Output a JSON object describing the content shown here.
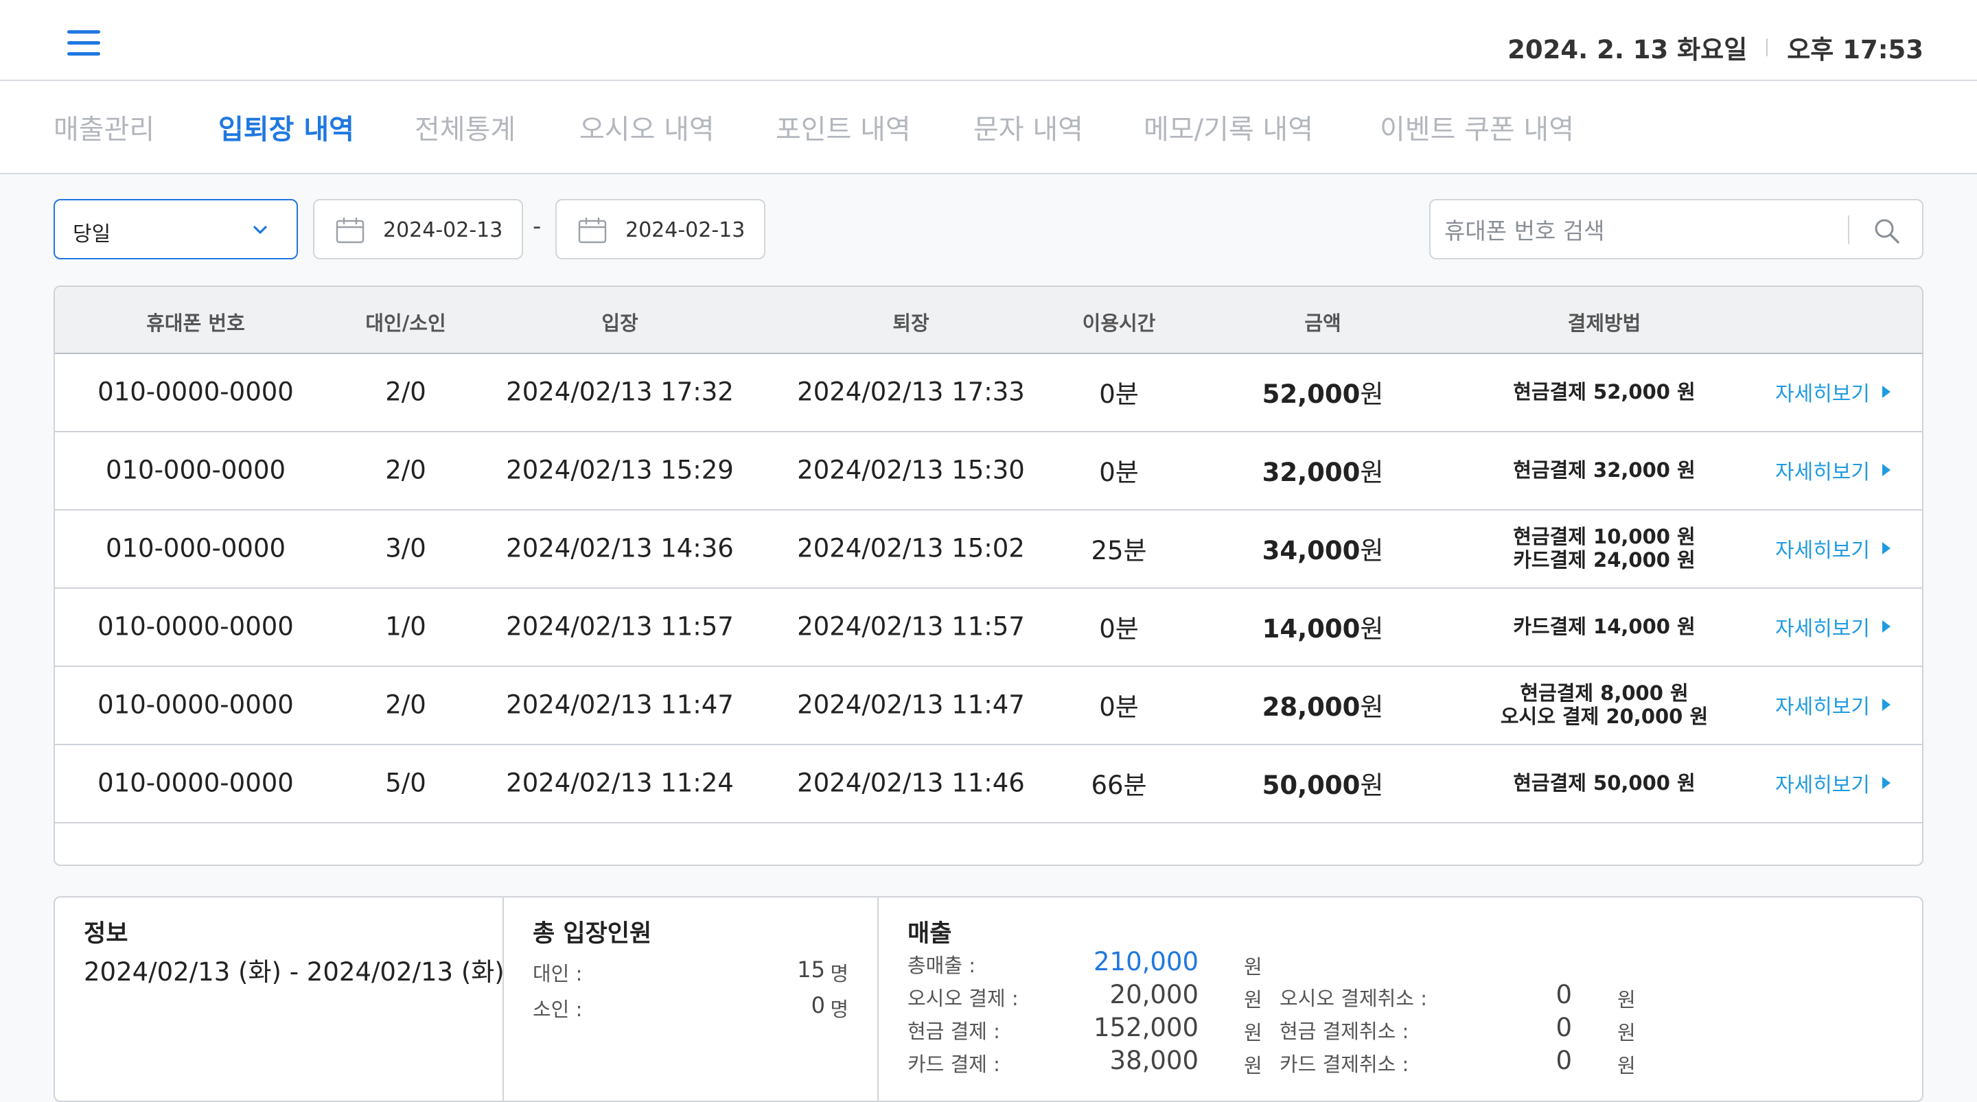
{
  "header": {
    "date": "2024. 2. 13 화요일",
    "time": "오후 17:53"
  },
  "tabs": [
    {
      "label": "매출관리",
      "active": false
    },
    {
      "label": "입퇴장 내역",
      "active": true
    },
    {
      "label": "전체통계",
      "active": false
    },
    {
      "label": "오시오 내역",
      "active": false
    },
    {
      "label": "포인트 내역",
      "active": false
    },
    {
      "label": "문자 내역",
      "active": false
    },
    {
      "label": "메모/기록 내역",
      "active": false
    },
    {
      "label": "이벤트 쿠폰 내역",
      "active": false
    }
  ],
  "filter": {
    "period": "당일",
    "start_date": "2024-02-13",
    "date_separator": "-",
    "end_date": "2024-02-13",
    "search_placeholder": "휴대폰 번호 검색"
  },
  "table": {
    "headers": [
      "휴대폰 번호",
      "대인/소인",
      "입장",
      "퇴장",
      "이용시간",
      "금액",
      "결제방법"
    ],
    "detail_label": "자세히보기",
    "rows": [
      {
        "phone": "010-0000-0000",
        "guests": "2/0",
        "entry": "2024/02/13 17:32",
        "exit": "2024/02/13 17:33",
        "duration": "0분",
        "amount": "52,000",
        "unit": "원",
        "pay1": "현금결제 52,000 원",
        "pay2": ""
      },
      {
        "phone": "010-000-0000",
        "guests": "2/0",
        "entry": "2024/02/13 15:29",
        "exit": "2024/02/13 15:30",
        "duration": "0분",
        "amount": "32,000",
        "unit": "원",
        "pay1": "현금결제 32,000 원",
        "pay2": ""
      },
      {
        "phone": "010-000-0000",
        "guests": "3/0",
        "entry": "2024/02/13 14:36",
        "exit": "2024/02/13 15:02",
        "duration": "25분",
        "amount": "34,000",
        "unit": "원",
        "pay1": "현금결제 10,000 원",
        "pay2": "카드결제 24,000 원"
      },
      {
        "phone": "010-0000-0000",
        "guests": "1/0",
        "entry": "2024/02/13 11:57",
        "exit": "2024/02/13 11:57",
        "duration": "0분",
        "amount": "14,000",
        "unit": "원",
        "pay1": "카드결제 14,000 원",
        "pay2": ""
      },
      {
        "phone": "010-0000-0000",
        "guests": "2/0",
        "entry": "2024/02/13 11:47",
        "exit": "2024/02/13 11:47",
        "duration": "0분",
        "amount": "28,000",
        "unit": "원",
        "pay1": "현금결제 8,000 원",
        "pay2": "오시오 결제 20,000 원"
      },
      {
        "phone": "010-0000-0000",
        "guests": "5/0",
        "entry": "2024/02/13 11:24",
        "exit": "2024/02/13 11:46",
        "duration": "66분",
        "amount": "50,000",
        "unit": "원",
        "pay1": "현금결제 50,000 원",
        "pay2": ""
      }
    ]
  },
  "summary": {
    "info": {
      "title": "정보",
      "range": "2024/02/13 (화)  -  2024/02/13 (화)"
    },
    "visitors": {
      "title": "총 입장인원",
      "adult_label": "대인 :",
      "adult_value": "15",
      "child_label": "소인 :",
      "child_value": "0",
      "unit": "명"
    },
    "sales": {
      "title": "매출",
      "total_label": "총매출 :",
      "total_value": "210,000",
      "osio_label": "오시오 결제 :",
      "osio_value": "20,000",
      "cash_label": "현금 결제 :",
      "cash_value": "152,000",
      "card_label": "카드 결제 :",
      "card_value": "38,000",
      "osio_cancel_label": "오시오 결제취소 :",
      "osio_cancel_value": "0",
      "cash_cancel_label": "현금 결제취소 :",
      "cash_cancel_value": "0",
      "card_cancel_label": "카드 결제취소 :",
      "card_cancel_value": "0",
      "unit": "원"
    }
  },
  "colors": {
    "accent": "#1f78e0",
    "link": "#1f9be0",
    "inactive_tab": "#b3b7bd"
  },
  "icons": [
    "hamburger-menu-icon",
    "chevron-down-icon",
    "calendar-icon",
    "search-icon",
    "caret-right-icon"
  ]
}
